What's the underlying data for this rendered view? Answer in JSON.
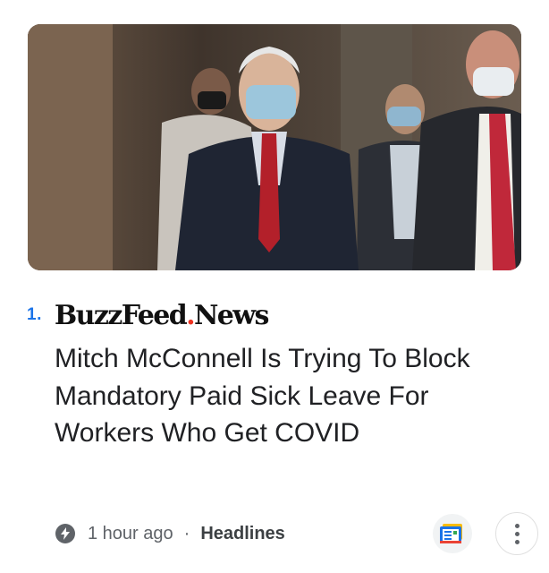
{
  "article": {
    "rank": "1.",
    "publisher_name": "BuzzFeed",
    "publisher_dot": ".",
    "publisher_section": "News",
    "headline": "Mitch McConnell Is Trying To Block Mandatory Paid Sick Leave For Workers Who Get COVID",
    "time": "1 hour ago",
    "separator": "·",
    "source": "Headlines",
    "image_alt": "Photo of Mitch McConnell wearing a face mask walking in a hallway with others"
  },
  "icons": {
    "time": "lightning-bolt-icon",
    "save": "google-news-icon",
    "more": "more-vertical-icon"
  },
  "colors": {
    "rank": "#1a73e8",
    "publisher_dot": "#ee3322",
    "meta_text": "#5f6368"
  }
}
